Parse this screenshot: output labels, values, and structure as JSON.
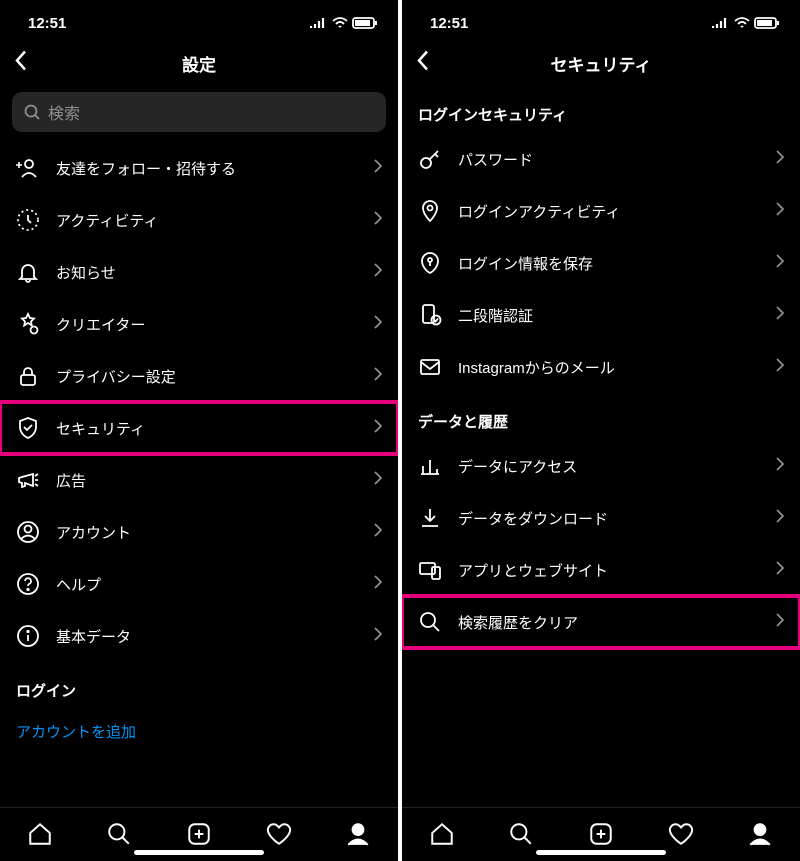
{
  "status": {
    "time": "12:51"
  },
  "left": {
    "title": "設定",
    "search_placeholder": "検索",
    "items": [
      {
        "icon": "add-person-icon",
        "label": "友達をフォロー・招待する"
      },
      {
        "icon": "activity-icon",
        "label": "アクティビティ"
      },
      {
        "icon": "bell-icon",
        "label": "お知らせ"
      },
      {
        "icon": "star-badge-icon",
        "label": "クリエイター"
      },
      {
        "icon": "lock-icon",
        "label": "プライバシー設定"
      },
      {
        "icon": "shield-icon",
        "label": "セキュリティ",
        "highlight": true
      },
      {
        "icon": "megaphone-icon",
        "label": "広告"
      },
      {
        "icon": "account-icon",
        "label": "アカウント"
      },
      {
        "icon": "help-icon",
        "label": "ヘルプ"
      },
      {
        "icon": "info-icon",
        "label": "基本データ"
      }
    ],
    "section_login": "ログイン",
    "add_account": "アカウントを追加"
  },
  "right": {
    "title": "セキュリティ",
    "section_login_security": "ログインセキュリティ",
    "login_items": [
      {
        "icon": "key-icon",
        "label": "パスワード"
      },
      {
        "icon": "pin-icon",
        "label": "ログインアクティビティ"
      },
      {
        "icon": "keyhole-icon",
        "label": "ログイン情報を保存"
      },
      {
        "icon": "twofa-icon",
        "label": "二段階認証"
      },
      {
        "icon": "mail-icon",
        "label": "Instagramからのメール"
      }
    ],
    "section_data": "データと履歴",
    "data_items": [
      {
        "icon": "bars-icon",
        "label": "データにアクセス"
      },
      {
        "icon": "download-icon",
        "label": "データをダウンロード"
      },
      {
        "icon": "devices-icon",
        "label": "アプリとウェブサイト"
      },
      {
        "icon": "search-icon",
        "label": "検索履歴をクリア",
        "highlight": true
      }
    ]
  }
}
